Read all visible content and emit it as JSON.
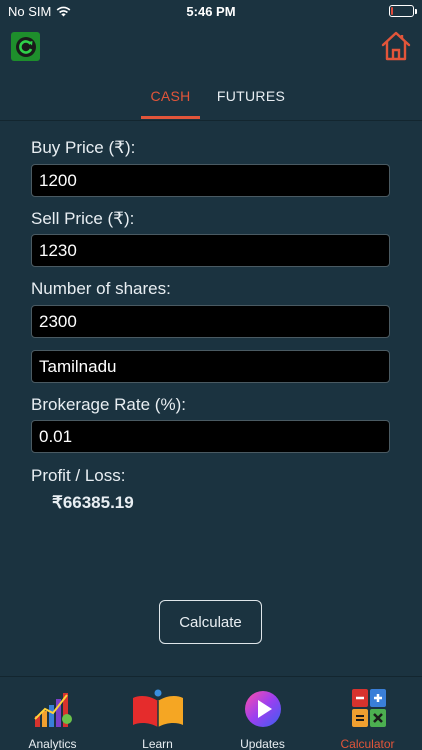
{
  "status": {
    "carrier": "No SIM",
    "time": "5:46 PM"
  },
  "header": {
    "refresh_icon": "refresh-icon",
    "home_icon": "home-icon"
  },
  "tabs": [
    {
      "label": "CASH",
      "active": true
    },
    {
      "label": "FUTURES",
      "active": false
    }
  ],
  "form": {
    "buy_price_label": "Buy Price (₹):",
    "buy_price_value": "1200",
    "sell_price_label": "Sell Price (₹):",
    "sell_price_value": "1230",
    "shares_label": "Number of shares:",
    "shares_value": "2300",
    "state_value": "Tamilnadu",
    "brokerage_label": "Brokerage Rate (%):",
    "brokerage_value": "0.01",
    "profit_label": "Profit / Loss:",
    "profit_value": "₹66385.19",
    "calculate_label": "Calculate"
  },
  "nav": [
    {
      "label": "Analytics",
      "icon": "analytics-icon",
      "active": false
    },
    {
      "label": "Learn",
      "icon": "book-icon",
      "active": false
    },
    {
      "label": "Updates",
      "icon": "play-icon",
      "active": false
    },
    {
      "label": "Calculator",
      "icon": "calculator-icon",
      "active": true
    }
  ],
  "colors": {
    "accent": "#e2553a",
    "background": "#1b3340",
    "field": "#000000"
  }
}
